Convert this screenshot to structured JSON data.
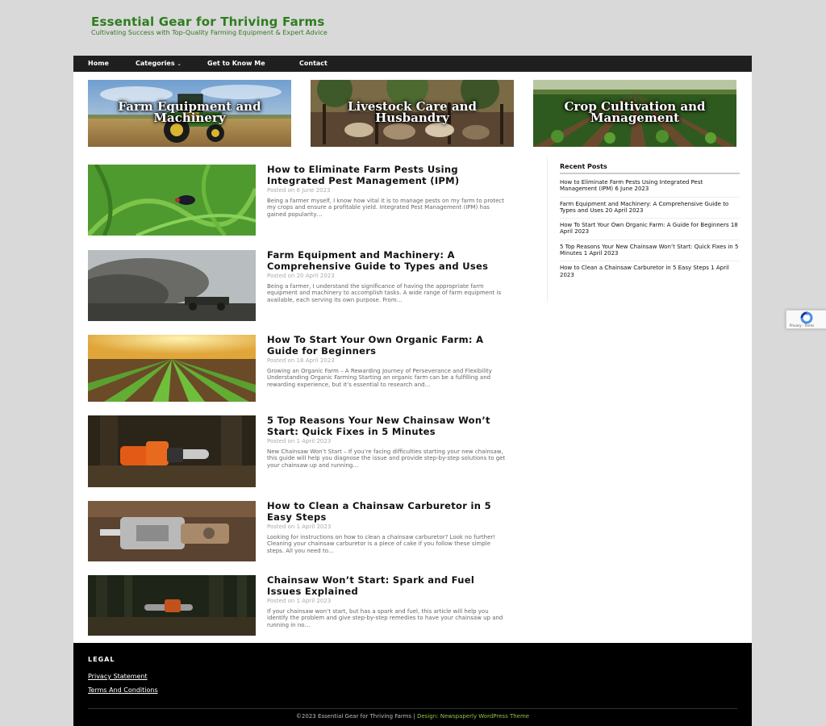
{
  "site": {
    "title": "Essential Gear for Thriving Farms",
    "tagline": "Cultivating Success with Top-Quality Farming Equipment & Expert Advice"
  },
  "nav": {
    "home": "Home",
    "categories": "Categories",
    "about": "Get to Know Me",
    "contact": "Contact"
  },
  "features": [
    {
      "title": "Farm Equipment and Machinery"
    },
    {
      "title": "Livestock Care and Husbandry"
    },
    {
      "title": "Crop Cultivation and Management"
    }
  ],
  "posts": [
    {
      "title": "How to Eliminate Farm Pests Using Integrated Pest Management (IPM)",
      "date": "Posted on 6 June 2023",
      "excerpt": "Being a farmer myself, I know how vital it is to manage pests on my farm to protect my crops and ensure a profitable yield. Integrated Pest Management (IPM) has gained popularity…"
    },
    {
      "title": "Farm Equipment and Machinery: A Comprehensive Guide to Types and Uses",
      "date": "Posted on 20 April 2023",
      "excerpt": "Being a farmer, I understand the significance of having the appropriate farm equipment and machinery to accomplish tasks. A wide range of farm equipment is available, each serving its own purpose. From…"
    },
    {
      "title": "How To Start Your Own Organic Farm: A Guide for Beginners",
      "date": "Posted on 18 April 2023",
      "excerpt": "Growing an Organic Farm – A Rewarding Journey of Perseverance and Flexibility Understanding Organic Farming Starting an organic farm can be a fulfilling and rewarding experience, but it’s essential to research and…"
    },
    {
      "title": "5 Top Reasons Your New Chainsaw Won’t Start: Quick Fixes in 5 Minutes",
      "date": "Posted on 1 April 2023",
      "excerpt": "New Chainsaw Won’t Start – If you’re facing difficulties starting your new chainsaw, this guide will help you diagnose the issue and provide step-by-step solutions to get your chainsaw up and running…"
    },
    {
      "title": "How to Clean a Chainsaw Carburetor in 5 Easy Steps",
      "date": "Posted on 1 April 2023",
      "excerpt": "Looking for instructions on how to clean a chainsaw carburetor? Look no further! Cleaning your chainsaw carburetor is a piece of cake if you follow these simple steps. All you need to…"
    },
    {
      "title": "Chainsaw Won’t Start: Spark and Fuel Issues Explained",
      "date": "Posted on 1 April 2023",
      "excerpt": "If your chainsaw won’t start, but has a spark and fuel, this article will help you identify the problem and give step-by-step remedies to have your chainsaw up and running in no…"
    }
  ],
  "sidebar": {
    "heading": "Recent Posts",
    "items": [
      "How to Eliminate Farm Pests Using Integrated Pest Management (IPM) 6 June 2023",
      "Farm Equipment and Machinery: A Comprehensive Guide to Types and Uses 20 April 2023",
      "How To Start Your Own Organic Farm: A Guide for Beginners 18 April 2023",
      "5 Top Reasons Your New Chainsaw Won’t Start: Quick Fixes in 5 Minutes 1 April 2023",
      "How to Clean a Chainsaw Carburetor in 5 Easy Steps 1 April 2023"
    ]
  },
  "recaptcha": {
    "terms": "Privacy - Terms"
  },
  "footer": {
    "legal_heading": "LEGAL",
    "privacy": "Privacy Statement",
    "terms": "Terms And Conditions",
    "copyright": "©2023 Essential Gear for Thriving Farms | ",
    "credit": "Design: Newspaperly WordPress Theme"
  },
  "colors": {
    "brand_green": "#2e7d1f",
    "nav_background": "#1f1f1f",
    "footer_background": "#000000",
    "credit_link": "#8bc34a"
  }
}
